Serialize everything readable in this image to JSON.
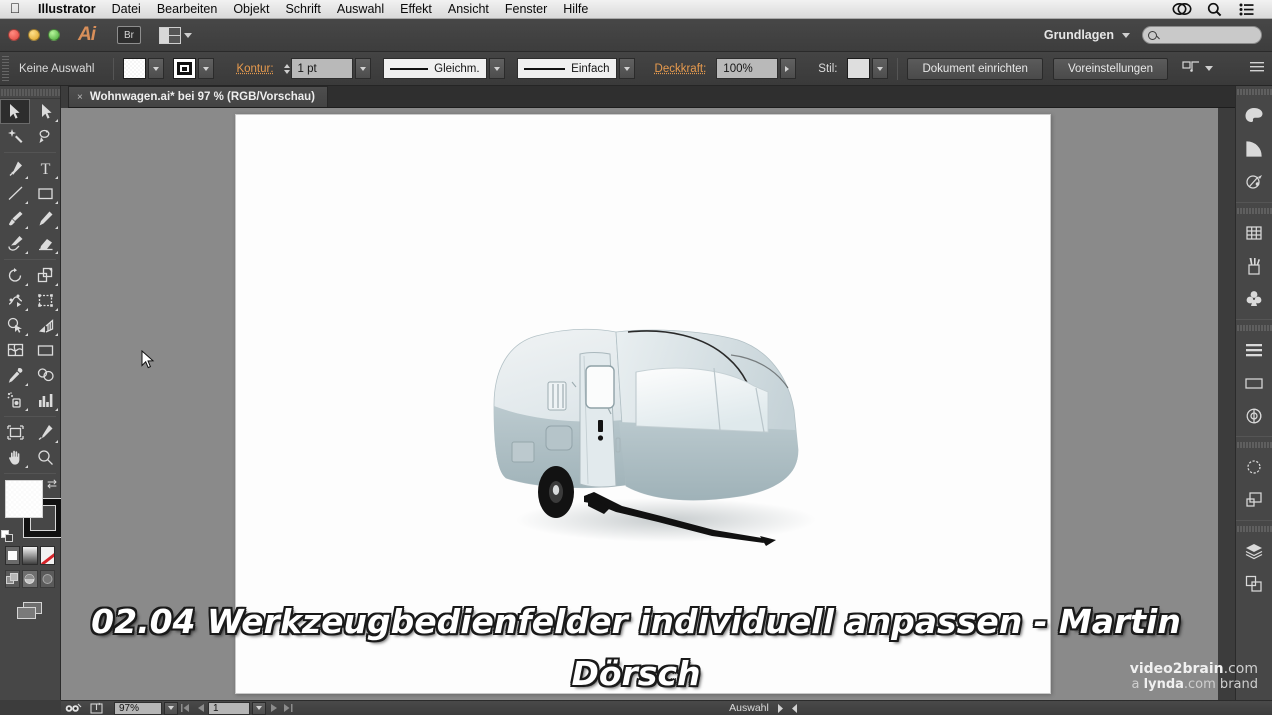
{
  "os_menu": {
    "apple_icon": "apple-icon",
    "items": [
      {
        "label": "Illustrator",
        "bold": true
      },
      {
        "label": "Datei"
      },
      {
        "label": "Bearbeiten"
      },
      {
        "label": "Objekt"
      },
      {
        "label": "Schrift"
      },
      {
        "label": "Auswahl"
      },
      {
        "label": "Effekt"
      },
      {
        "label": "Ansicht"
      },
      {
        "label": "Fenster"
      },
      {
        "label": "Hilfe"
      }
    ],
    "right_icons": [
      "creative-cloud-icon",
      "spotlight-search-icon",
      "notification-center-icon"
    ]
  },
  "app_bar": {
    "logo": "Ai",
    "bridge_label": "Br",
    "arrange_label": "arrange-documents",
    "workspace": "Grundlagen",
    "search_placeholder": ""
  },
  "control_bar": {
    "selection_status": "Keine Auswahl",
    "fill_label": "fill-swatch",
    "stroke_label": "stroke-swatch",
    "stroke_weight_label": "Kontur:",
    "stroke_weight_value": "1 pt",
    "stroke_profile": "Gleichm.",
    "brush_definition": "Einfach",
    "opacity_label": "Deckkraft:",
    "opacity_value": "100%",
    "style_label": "Stil:",
    "document_setup": "Dokument einrichten",
    "preferences": "Voreinstellungen"
  },
  "tab": {
    "close_glyph": "×",
    "title": "Wohnwagen.ai* bei 97 % (RGB/Vorschau)"
  },
  "toolbar": {
    "tools": [
      {
        "name": "selection-tool",
        "selected": true,
        "corner": false
      },
      {
        "name": "direct-selection-tool",
        "selected": false,
        "corner": true
      },
      {
        "name": "magic-wand-tool",
        "selected": false,
        "corner": false
      },
      {
        "name": "lasso-tool",
        "selected": false,
        "corner": false
      },
      {
        "name": "pen-tool",
        "selected": false,
        "corner": true
      },
      {
        "name": "type-tool",
        "selected": false,
        "corner": true
      },
      {
        "name": "line-segment-tool",
        "selected": false,
        "corner": true
      },
      {
        "name": "rectangle-tool",
        "selected": false,
        "corner": true
      },
      {
        "name": "paintbrush-tool",
        "selected": false,
        "corner": true
      },
      {
        "name": "pencil-tool",
        "selected": false,
        "corner": true
      },
      {
        "name": "blob-brush-tool",
        "selected": false,
        "corner": true
      },
      {
        "name": "eraser-tool",
        "selected": false,
        "corner": true
      },
      {
        "name": "rotate-tool",
        "selected": false,
        "corner": true
      },
      {
        "name": "scale-tool",
        "selected": false,
        "corner": true
      },
      {
        "name": "width-tool",
        "selected": false,
        "corner": true
      },
      {
        "name": "free-transform-tool",
        "selected": false,
        "corner": true
      },
      {
        "name": "shape-builder-tool",
        "selected": false,
        "corner": true
      },
      {
        "name": "perspective-grid-tool",
        "selected": false,
        "corner": true
      },
      {
        "name": "mesh-tool",
        "selected": false,
        "corner": false
      },
      {
        "name": "gradient-tool",
        "selected": false,
        "corner": false
      },
      {
        "name": "eyedropper-tool",
        "selected": false,
        "corner": true
      },
      {
        "name": "blend-tool",
        "selected": false,
        "corner": false
      },
      {
        "name": "symbol-sprayer-tool",
        "selected": false,
        "corner": true
      },
      {
        "name": "column-graph-tool",
        "selected": false,
        "corner": true
      },
      {
        "name": "artboard-tool",
        "selected": false,
        "corner": false
      },
      {
        "name": "slice-tool",
        "selected": false,
        "corner": true
      },
      {
        "name": "hand-tool",
        "selected": false,
        "corner": true
      },
      {
        "name": "zoom-tool",
        "selected": false,
        "corner": false
      }
    ],
    "fill_swatch": "white",
    "stroke_swatch": "black",
    "color_modes": [
      "color-mode",
      "gradient-mode",
      "none-mode"
    ],
    "draw_modes": [
      "draw-normal",
      "draw-behind",
      "draw-inside"
    ],
    "screen_mode": "change-screen-mode"
  },
  "dock": {
    "panels": [
      {
        "name": "color-panel-icon"
      },
      {
        "name": "color-guide-panel-icon"
      },
      {
        "name": "transparency-panel-icon"
      },
      {
        "name": "swatches-panel-icon"
      },
      {
        "name": "brushes-panel-icon"
      },
      {
        "name": "symbols-panel-icon"
      },
      {
        "name": "align-panel-icon"
      },
      {
        "name": "gradient-panel-icon"
      },
      {
        "name": "appearance-panel-icon"
      },
      {
        "name": "graphic-styles-panel-icon"
      },
      {
        "name": "transform-panel-icon"
      },
      {
        "name": "layers-panel-icon"
      },
      {
        "name": "artboards-panel-icon"
      }
    ]
  },
  "status_bar": {
    "zoom_value": "97%",
    "page_value": "1",
    "status_text": "Auswahl"
  },
  "subtitle": {
    "line1": "02.04 Werkzeugbedienfelder individuell anpassen - Martin",
    "line2": "Dörsch"
  },
  "watermark": {
    "line1_bold": "video2brain",
    "line1_rest": ".com",
    "line2_pre": "a ",
    "line2_bold": "lynda",
    "line2_rest": ".com brand"
  },
  "artwork": {
    "name": "caravan-illustration",
    "description": "Airstream-style travel trailer"
  },
  "colors": {
    "accent_orange": "#e89b4e",
    "panel_bg": "#474747",
    "canvas_bg": "#8a8a8a",
    "artboard_bg": "#fdfdfd"
  }
}
